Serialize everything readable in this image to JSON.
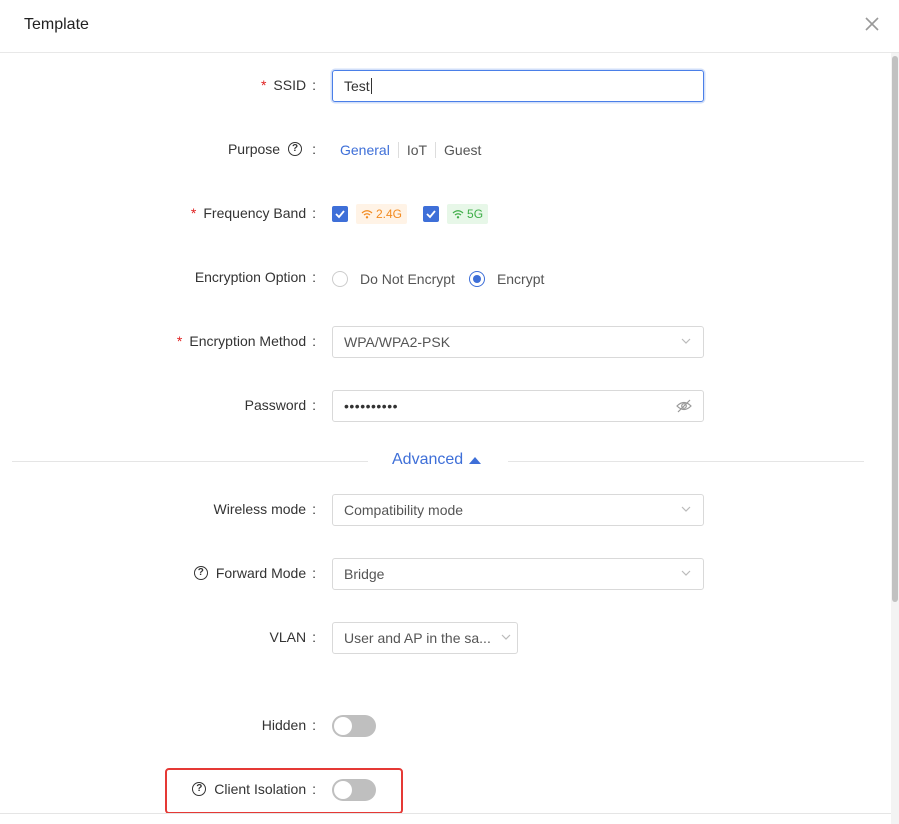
{
  "dialog": {
    "title": "Template"
  },
  "form": {
    "ssid": {
      "label": "SSID",
      "value": "Test"
    },
    "purpose": {
      "label": "Purpose",
      "options": [
        "General",
        "IoT",
        "Guest"
      ],
      "selected": "General"
    },
    "frequency_band": {
      "label": "Frequency Band",
      "bands": [
        "2.4G",
        "5G"
      ]
    },
    "encryption_option": {
      "label": "Encryption Option",
      "options": [
        "Do Not Encrypt",
        "Encrypt"
      ],
      "selected": "Encrypt"
    },
    "encryption_method": {
      "label": "Encryption Method",
      "value": "WPA/WPA2-PSK"
    },
    "password": {
      "label": "Password",
      "value": "••••••••••"
    },
    "advanced": {
      "label": "Advanced"
    },
    "wireless_mode": {
      "label": "Wireless mode",
      "value": "Compatibility mode"
    },
    "forward_mode": {
      "label": "Forward Mode",
      "value": "Bridge"
    },
    "vlan": {
      "label": "VLAN",
      "value": "User and AP in the sa..."
    },
    "hidden": {
      "label": "Hidden",
      "on": false
    },
    "client_isolation": {
      "label": "Client Isolation",
      "on": false
    }
  },
  "colors": {
    "accent": "#3e6fd8",
    "required": "#e02020",
    "band_24": "#f28a1f",
    "band_5": "#3fae48",
    "highlight": "#e53935"
  }
}
